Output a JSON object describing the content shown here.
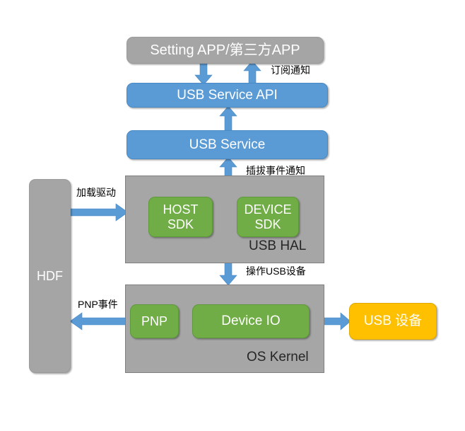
{
  "diagram": {
    "title": "USB subsystem architecture",
    "colors": {
      "blue": "#5b9bd5",
      "green": "#70ad47",
      "gray": "#a6a6a6",
      "gray_round": "#a5a5a5",
      "yellow": "#ffc000",
      "arrow": "#5b9bd5",
      "text_light": "#ffffff",
      "text_dark": "#262626",
      "background": "#ffffff"
    },
    "nodes": {
      "setting_app": "Setting APP/第三方APP",
      "usb_service_api": "USB Service API",
      "usb_service": "USB Service",
      "usb_hal_label": "USB HAL",
      "host_sdk_line1": "HOST",
      "host_sdk_line2": "SDK",
      "device_sdk_line1": "DEVICE",
      "device_sdk_line2": "SDK",
      "os_kernel_label": "OS Kernel",
      "pnp": "PNP",
      "device_io": "Device IO",
      "hdf": "HDF",
      "usb_device": "USB 设备"
    },
    "edge_labels": {
      "subscribe_notify": "订阅通知",
      "plug_event_notify": "插拔事件通知",
      "operate_usb_device": "操作USB设备",
      "load_driver": "加载驱动",
      "pnp_event": "PNP事件"
    }
  }
}
